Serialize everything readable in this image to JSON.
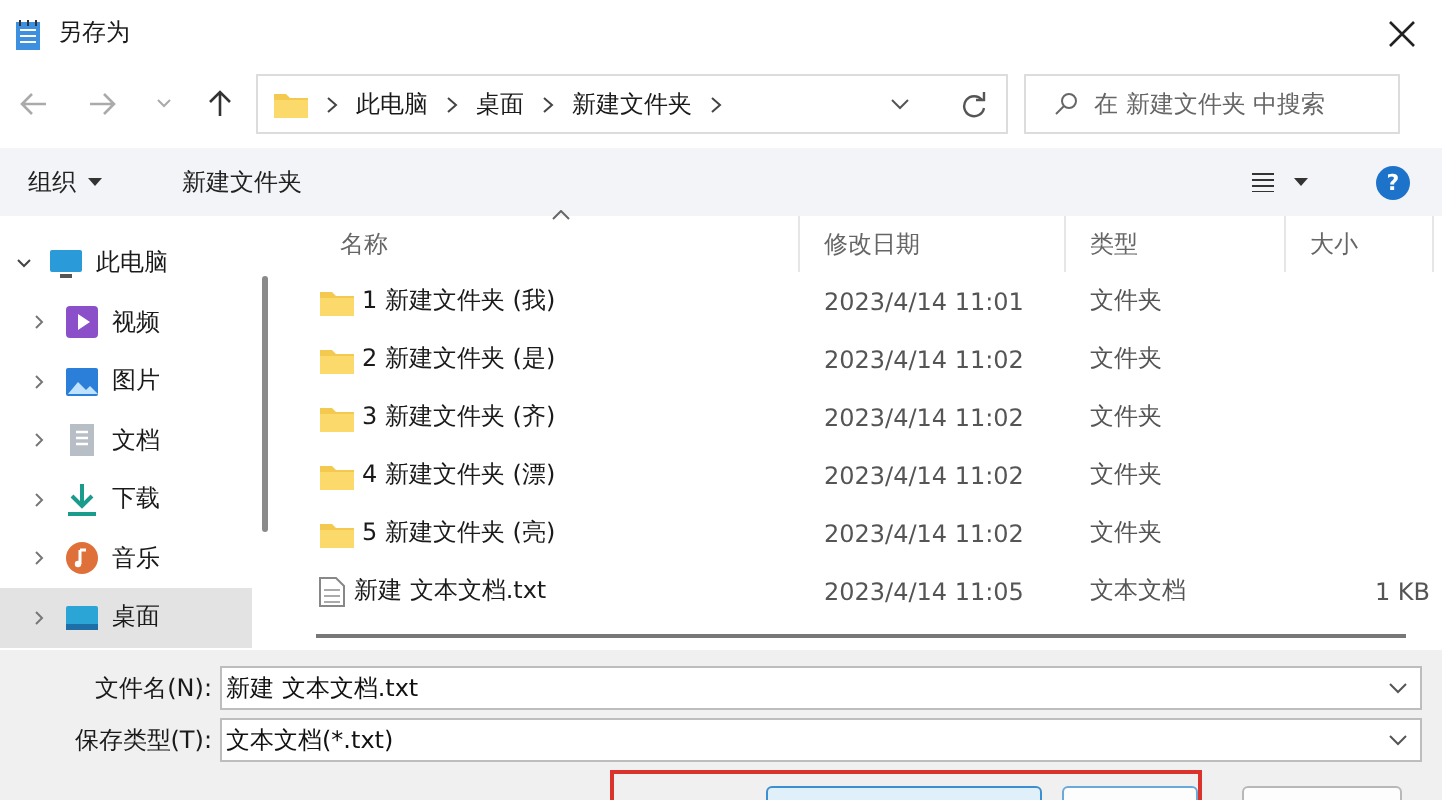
{
  "window": {
    "title": "另存为"
  },
  "address_bar": {
    "path": [
      "此电脑",
      "桌面",
      "新建文件夹"
    ]
  },
  "search": {
    "placeholder": "在 新建文件夹 中搜索"
  },
  "toolbar": {
    "organize": "组织",
    "new_folder": "新建文件夹",
    "help": "?"
  },
  "sidebar": {
    "items": [
      {
        "label": "此电脑",
        "kind": "computer",
        "expanded": true,
        "selected": false,
        "children": [
          {
            "label": "视频",
            "kind": "videos",
            "expanded": false,
            "selected": false
          },
          {
            "label": "图片",
            "kind": "pictures",
            "expanded": false,
            "selected": false
          },
          {
            "label": "文档",
            "kind": "documents",
            "expanded": false,
            "selected": false
          },
          {
            "label": "下载",
            "kind": "downloads",
            "expanded": false,
            "selected": false
          },
          {
            "label": "音乐",
            "kind": "music",
            "expanded": false,
            "selected": false
          },
          {
            "label": "桌面",
            "kind": "desktop",
            "expanded": false,
            "selected": true
          }
        ]
      }
    ]
  },
  "table": {
    "columns": [
      "名称",
      "修改日期",
      "类型",
      "大小"
    ],
    "rows": [
      {
        "kind": "folder",
        "name": "1 新建文件夹 (我)",
        "modified": "2023/4/14 11:01",
        "type": "文件夹"
      },
      {
        "kind": "folder",
        "name": "2 新建文件夹 (是)",
        "modified": "2023/4/14 11:02",
        "type": "文件夹"
      },
      {
        "kind": "folder",
        "name": "3 新建文件夹 (齐)",
        "modified": "2023/4/14 11:02",
        "type": "文件夹"
      },
      {
        "kind": "folder",
        "name": "4 新建文件夹 (漂)",
        "modified": "2023/4/14 11:02",
        "type": "文件夹"
      },
      {
        "kind": "folder",
        "name": "5 新建文件夹 (亮)",
        "modified": "2023/4/14 11:02",
        "type": "文件夹"
      },
      {
        "kind": "text",
        "name": "新建 文本文档.txt",
        "modified": "2023/4/14 11:05",
        "type": "文本文档",
        "size": "1 KB"
      }
    ]
  },
  "form": {
    "file_name": {
      "label": "文件名(N):",
      "value": "新建 文本文档.txt"
    },
    "file_type": {
      "label": "保存类型(T):",
      "value": "文本文档(*.txt)"
    }
  },
  "buttons": [
    {
      "default": true
    },
    {
      "default": false
    },
    {
      "default": false
    }
  ]
}
